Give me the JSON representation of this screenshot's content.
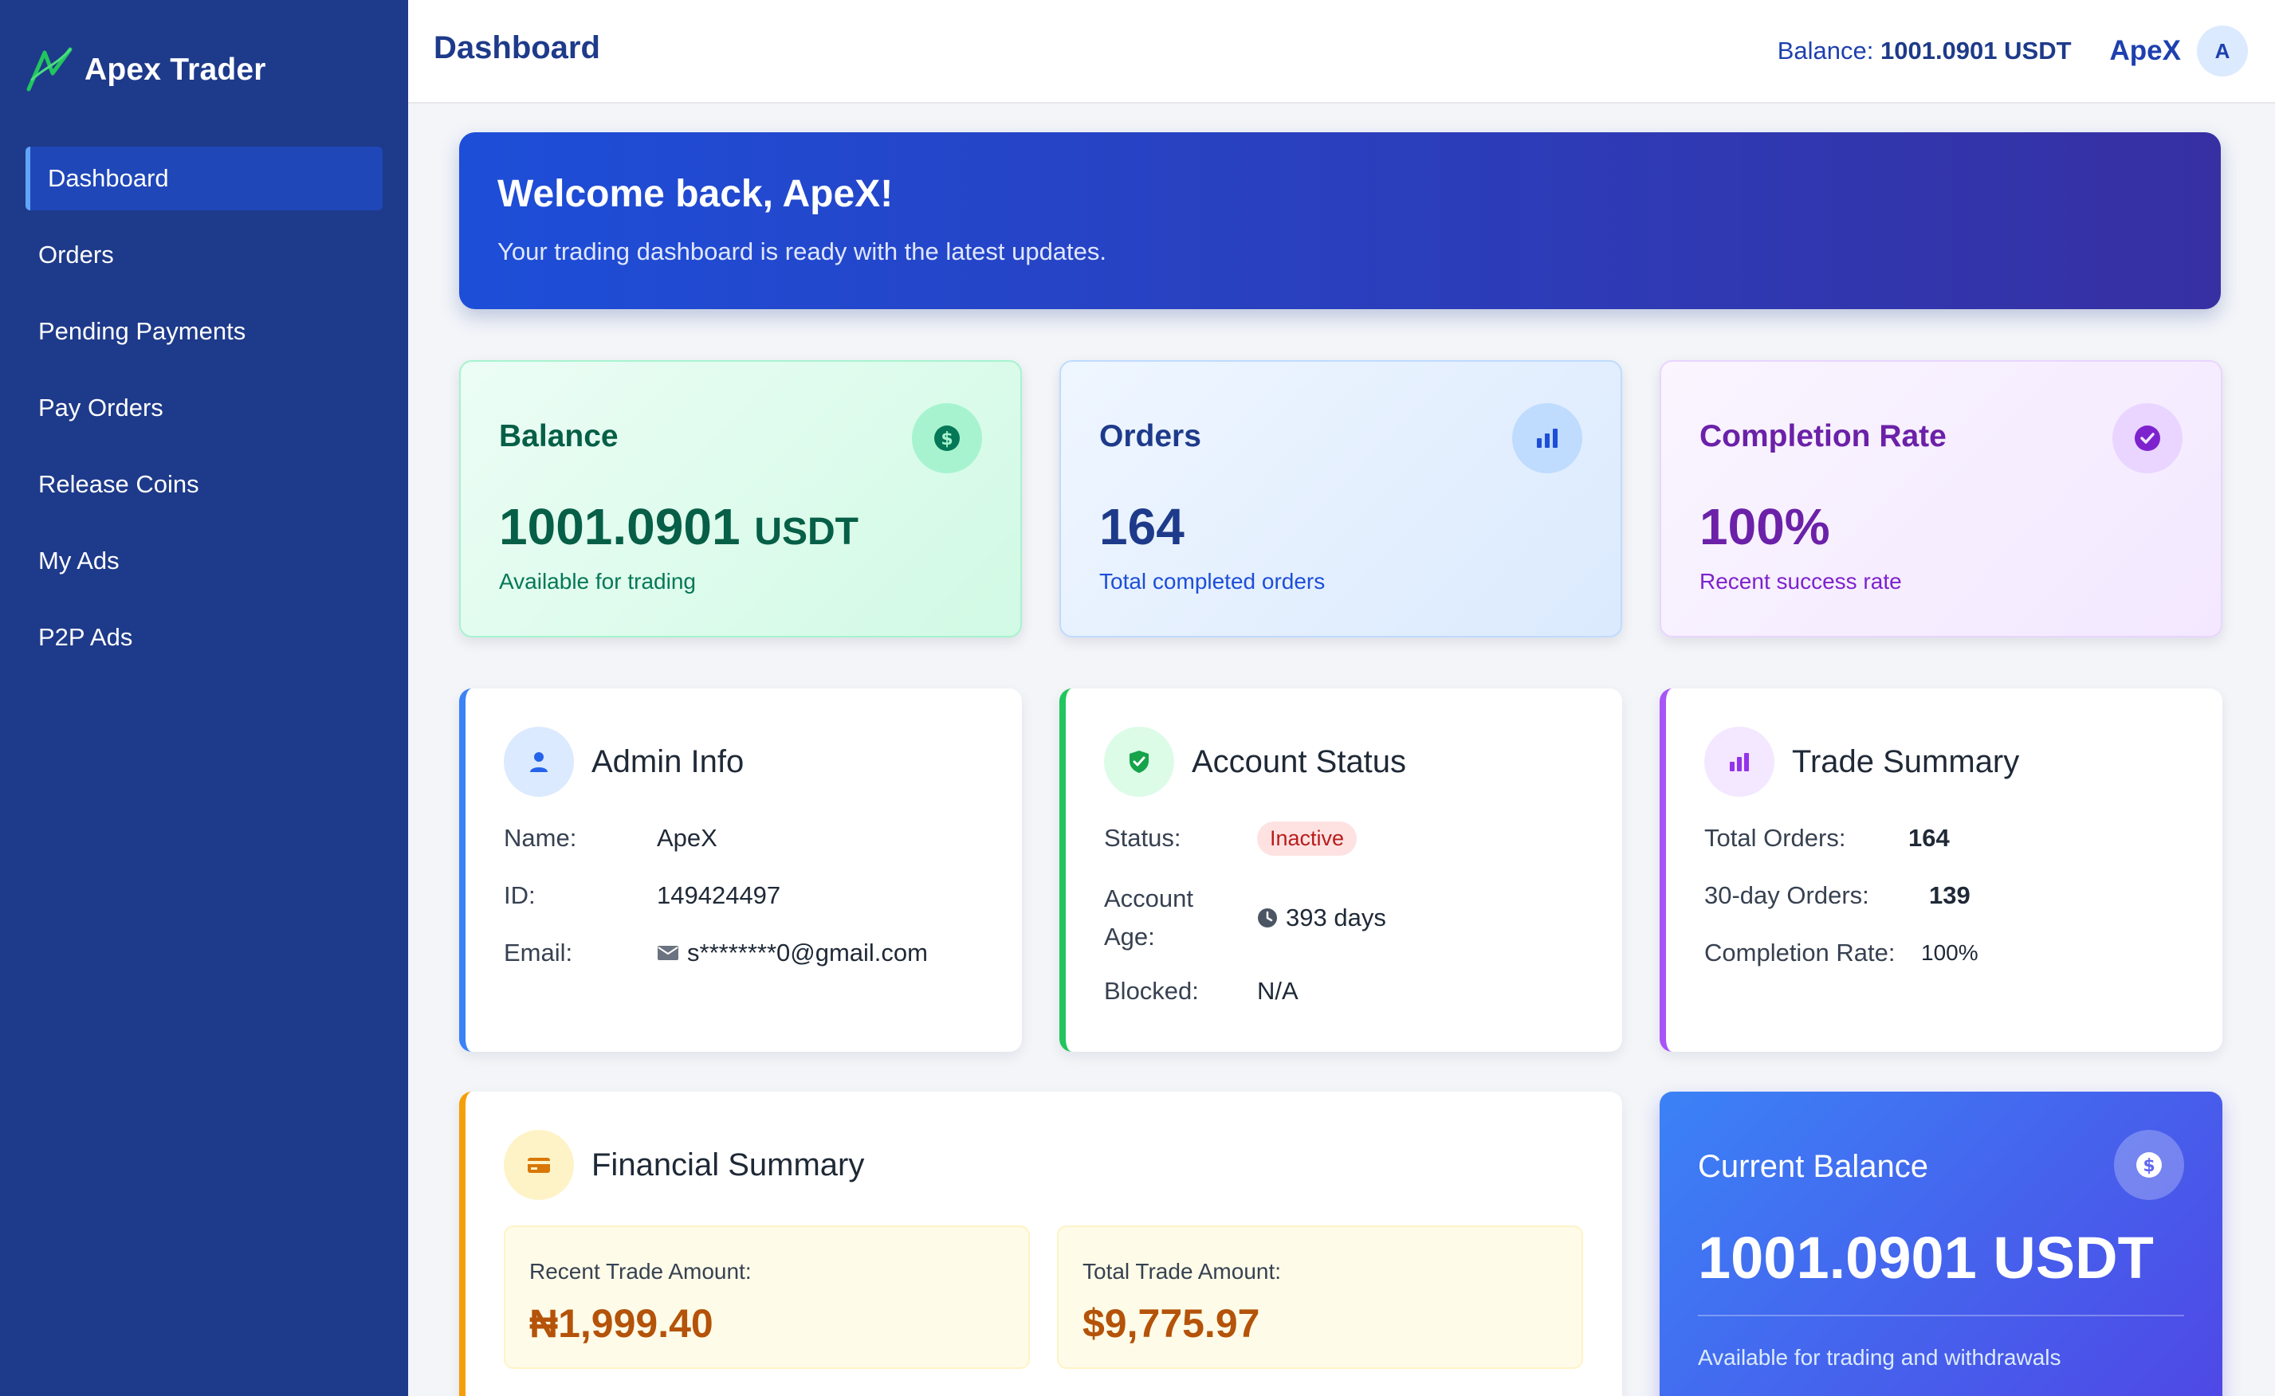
{
  "app": {
    "name": "Apex Trader"
  },
  "sidebar": {
    "items": [
      {
        "label": "Dashboard",
        "active": true
      },
      {
        "label": "Orders"
      },
      {
        "label": "Pending Payments"
      },
      {
        "label": "Pay Orders"
      },
      {
        "label": "Release Coins"
      },
      {
        "label": "My Ads"
      },
      {
        "label": "P2P Ads"
      }
    ]
  },
  "header": {
    "title": "Dashboard",
    "balance_label": "Balance:",
    "balance_value": "1001.0901 USDT",
    "username": "ApeX",
    "avatar_initial": "A"
  },
  "welcome": {
    "title": "Welcome back, ApeX!",
    "subtitle": "Your trading dashboard is ready with the latest updates."
  },
  "stats": {
    "balance": {
      "title": "Balance",
      "value": "1001.0901",
      "unit": "USDT",
      "sub": "Available for trading",
      "icon": "dollar-icon"
    },
    "orders": {
      "title": "Orders",
      "value": "164",
      "sub": "Total completed orders",
      "icon": "bar-chart-icon"
    },
    "completion": {
      "title": "Completion Rate",
      "value": "100%",
      "sub": "Recent success rate",
      "icon": "check-circle-icon"
    }
  },
  "admin_info": {
    "title": "Admin Info",
    "name_label": "Name:",
    "name": "ApeX",
    "id_label": "ID:",
    "id": "149424497",
    "email_label": "Email:",
    "email": "s********0@gmail.com"
  },
  "account_status": {
    "title": "Account Status",
    "status_label": "Status:",
    "status": "Inactive",
    "age_label_1": "Account",
    "age_label_2": "Age:",
    "age": "393 days",
    "blocked_label": "Blocked:",
    "blocked": "N/A"
  },
  "trade_summary": {
    "title": "Trade Summary",
    "total_label": "Total Orders:",
    "total": "164",
    "thirty_label": "30-day Orders:",
    "thirty": "139",
    "rate_label": "Completion Rate:",
    "rate": "100%"
  },
  "financial_summary": {
    "title": "Financial Summary",
    "recent_label": "Recent Trade Amount:",
    "recent": "₦1,999.40",
    "total_label": "Total Trade Amount:",
    "total": "$9,775.97"
  },
  "current_balance": {
    "title": "Current Balance",
    "value": "1001.0901 USDT",
    "sub": "Available for trading and withdrawals"
  },
  "colors": {
    "sidebar": "#1e3a8a",
    "accent_blue": "#1d4ed8",
    "success": "#065f46",
    "purple": "#6b21a8",
    "amber": "#b45309"
  }
}
